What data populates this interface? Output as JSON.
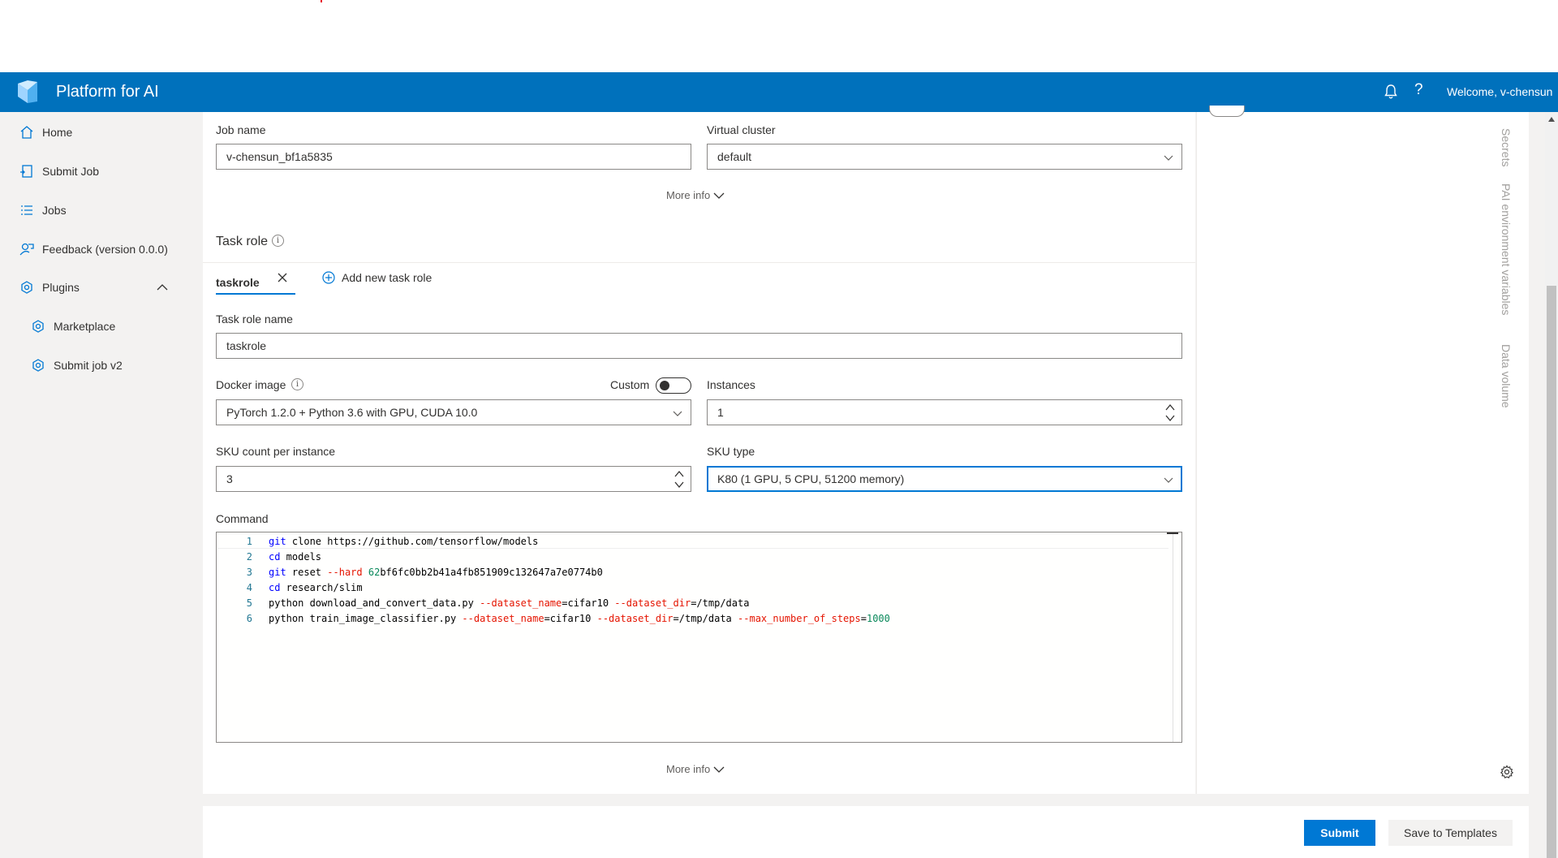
{
  "header": {
    "title": "Platform for AI",
    "help_label": "?",
    "welcome": "Welcome, v-chensun"
  },
  "sidebar": {
    "items": [
      {
        "label": "Home",
        "icon": "home-icon"
      },
      {
        "label": "Submit Job",
        "icon": "submit-job-icon"
      },
      {
        "label": "Jobs",
        "icon": "list-icon"
      },
      {
        "label": "Feedback (version 0.0.0)",
        "icon": "feedback-icon"
      },
      {
        "label": "Plugins",
        "icon": "plugin-icon"
      },
      {
        "label": "Marketplace",
        "icon": "plugin-icon"
      },
      {
        "label": "Submit job v2",
        "icon": "plugin-icon"
      }
    ]
  },
  "form": {
    "job_name_label": "Job name",
    "job_name_value": "v-chensun_bf1a5835",
    "virtual_cluster_label": "Virtual cluster",
    "virtual_cluster_value": "default",
    "more_info": "More info",
    "task_role_title": "Task role",
    "task_role_info": "i",
    "tab_label": "taskrole",
    "add_task_role": "Add new task role",
    "task_role_name_label": "Task role name",
    "task_role_name_value": "taskrole",
    "docker_image_label": "Docker image",
    "docker_custom_label": "Custom",
    "docker_image_value": "PyTorch 1.2.0 + Python 3.6 with GPU, CUDA 10.0",
    "instances_label": "Instances",
    "instances_value": "1",
    "sku_count_label": "SKU count per instance",
    "sku_count_value": "3",
    "sku_type_label": "SKU type",
    "sku_type_value": "K80 (1 GPU, 5 CPU, 51200 memory)",
    "command_label": "Command",
    "more_info_bottom": "More info"
  },
  "command_lines": [
    {
      "n": "1",
      "parts": [
        [
          "kw",
          "git"
        ],
        [
          "txt",
          " clone https://github.com/tensorflow/models"
        ]
      ]
    },
    {
      "n": "2",
      "parts": [
        [
          "kw",
          "cd"
        ],
        [
          "txt",
          " models"
        ]
      ]
    },
    {
      "n": "3",
      "parts": [
        [
          "kw",
          "git"
        ],
        [
          "txt",
          " reset "
        ],
        [
          "opt",
          "--hard"
        ],
        [
          "txt",
          " "
        ],
        [
          "num",
          "62"
        ],
        [
          "txt",
          "bf6fc0bb2b41a4fb851909c132647a7e0774b0"
        ]
      ]
    },
    {
      "n": "4",
      "parts": [
        [
          "kw",
          "cd"
        ],
        [
          "txt",
          " research/slim"
        ]
      ]
    },
    {
      "n": "5",
      "parts": [
        [
          "txt",
          "python download_and_convert_data.py "
        ],
        [
          "opt",
          "--dataset_name"
        ],
        [
          "txt",
          "=cifar10 "
        ],
        [
          "opt",
          "--dataset_dir"
        ],
        [
          "txt",
          "=/tmp/data"
        ]
      ]
    },
    {
      "n": "6",
      "parts": [
        [
          "txt",
          "python train_image_classifier.py "
        ],
        [
          "opt",
          "--dataset_name"
        ],
        [
          "txt",
          "=cifar10 "
        ],
        [
          "opt",
          "--dataset_dir"
        ],
        [
          "txt",
          "=/tmp/data "
        ],
        [
          "opt",
          "--max_number_of_steps"
        ],
        [
          "txt",
          "="
        ],
        [
          "num",
          "1000"
        ]
      ]
    }
  ],
  "side_tabs": {
    "secrets": "Secrets",
    "pai_env": "PAI environment variables",
    "data_volume": "Data volume"
  },
  "footer": {
    "submit": "Submit",
    "save_templates": "Save to Templates"
  },
  "colors": {
    "header_bg": "#0071bc",
    "primary": "#0078d4",
    "keyword": "#0000ff",
    "option": "#e51400",
    "number": "#09885a"
  }
}
